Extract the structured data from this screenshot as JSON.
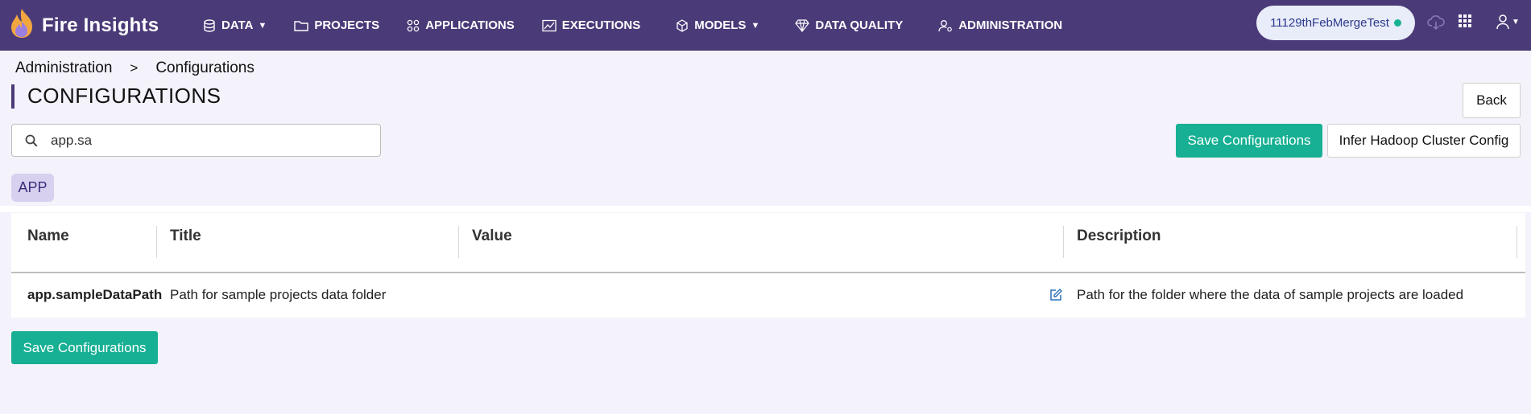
{
  "app": {
    "name": "Fire Insights"
  },
  "nav": {
    "items": [
      {
        "label": "DATA",
        "icon": "database-icon",
        "dropdown": true
      },
      {
        "label": "PROJECTS",
        "icon": "folder-icon",
        "dropdown": false
      },
      {
        "label": "APPLICATIONS",
        "icon": "grid-circles-icon",
        "dropdown": false
      },
      {
        "label": "EXECUTIONS",
        "icon": "line-chart-icon",
        "dropdown": false
      },
      {
        "label": "MODELS",
        "icon": "cube-icon",
        "dropdown": true
      },
      {
        "label": "DATA QUALITY",
        "icon": "diamond-icon",
        "dropdown": false
      },
      {
        "label": "ADMINISTRATION",
        "icon": "user-gear-icon",
        "dropdown": false
      }
    ],
    "workspace": "11129thFebMergeTest",
    "workspace_status_color": "#18b394"
  },
  "breadcrumb": [
    "Administration",
    "Configurations"
  ],
  "page": {
    "title": "CONFIGURATIONS",
    "back_label": "Back",
    "save_label": "Save Configurations",
    "infer_label": "Infer Hadoop Cluster Config",
    "save_bottom_label": "Save Configurations"
  },
  "search": {
    "value": "app.sa",
    "placeholder": ""
  },
  "filter_chip": "APP",
  "table": {
    "headers": [
      "Name",
      "Title",
      "Value",
      "Description"
    ],
    "rows": [
      {
        "name": "app.sampleDataPath",
        "title": "Path for sample projects data folder",
        "value": "",
        "description": "Path for the folder where the data of sample projects are loaded"
      }
    ]
  },
  "colors": {
    "nav_bg": "#4b3a78",
    "accent_green": "#17b094",
    "chip_bg": "#d7d0ef",
    "page_bg": "#f4f2fa"
  }
}
